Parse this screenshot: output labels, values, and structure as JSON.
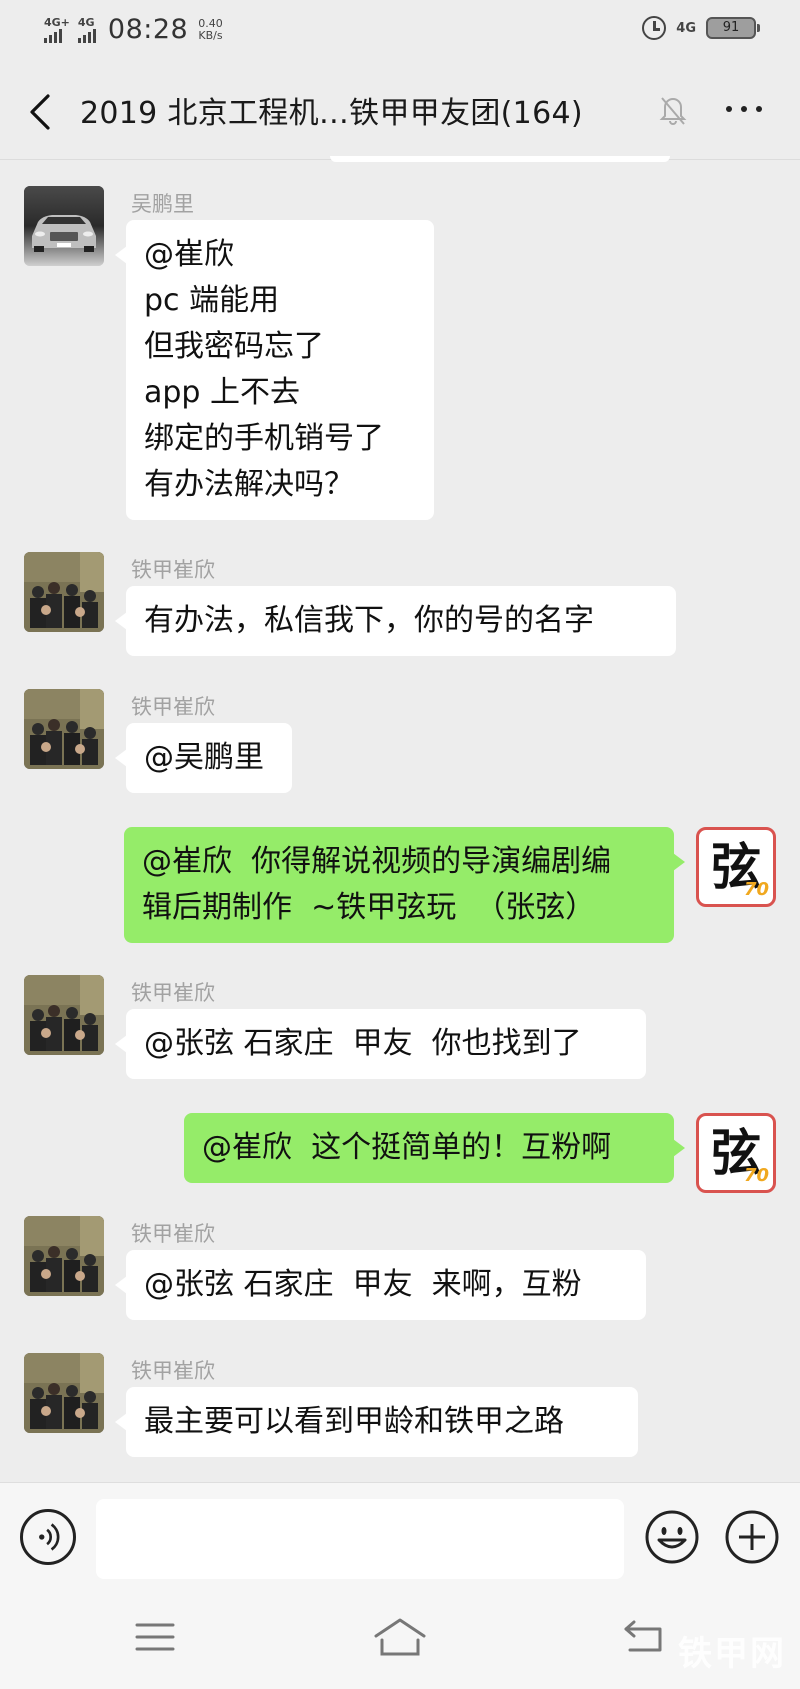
{
  "status_bar": {
    "sig1_label": "4G+",
    "sig2_label": "4G",
    "time": "08:28",
    "speed_value": "0.40",
    "speed_unit": "KB/s",
    "network_label": "4G",
    "battery": "91"
  },
  "header": {
    "title": "2019 北京工程机…铁甲甲友团(164)"
  },
  "messages": [
    {
      "side": "left",
      "sender": "吴鹏里",
      "avatar": "car-avatar",
      "text": "@崔欣\npc 端能用\n但我密码忘了\napp 上不去\n绑定的手机销号了\n有办法解决吗？"
    },
    {
      "side": "left",
      "sender": "铁甲崔欣",
      "avatar": "group-photo-avatar",
      "text": "有办法，私信我下，你的号的名字"
    },
    {
      "side": "left",
      "sender": "铁甲崔欣",
      "avatar": "group-photo-avatar",
      "text": "@吴鹏里"
    },
    {
      "side": "right",
      "sender": "",
      "avatar": "xian-avatar",
      "text": "@崔欣  你得解说视频的导演编剧编\n辑后期制作  ~铁甲弦玩  （张弦）"
    },
    {
      "side": "left",
      "sender": "铁甲崔欣",
      "avatar": "group-photo-avatar",
      "text": "@张弦 石家庄  甲友  你也找到了"
    },
    {
      "side": "right",
      "sender": "",
      "avatar": "xian-avatar",
      "text": "@崔欣  这个挺简单的！互粉啊"
    },
    {
      "side": "left",
      "sender": "铁甲崔欣",
      "avatar": "group-photo-avatar",
      "text": "@张弦 石家庄  甲友  来啊，互粉"
    },
    {
      "side": "left",
      "sender": "铁甲崔欣",
      "avatar": "group-photo-avatar",
      "text": "最主要可以看到甲龄和铁甲之路"
    }
  ],
  "xian_avatar": {
    "glyph": "弦",
    "badge": "70"
  },
  "input": {
    "value": "",
    "placeholder": ""
  },
  "watermark": "铁甲网",
  "colors": {
    "right_bubble": "#95ec69",
    "left_bubble": "#ffffff",
    "background": "#ededed"
  }
}
